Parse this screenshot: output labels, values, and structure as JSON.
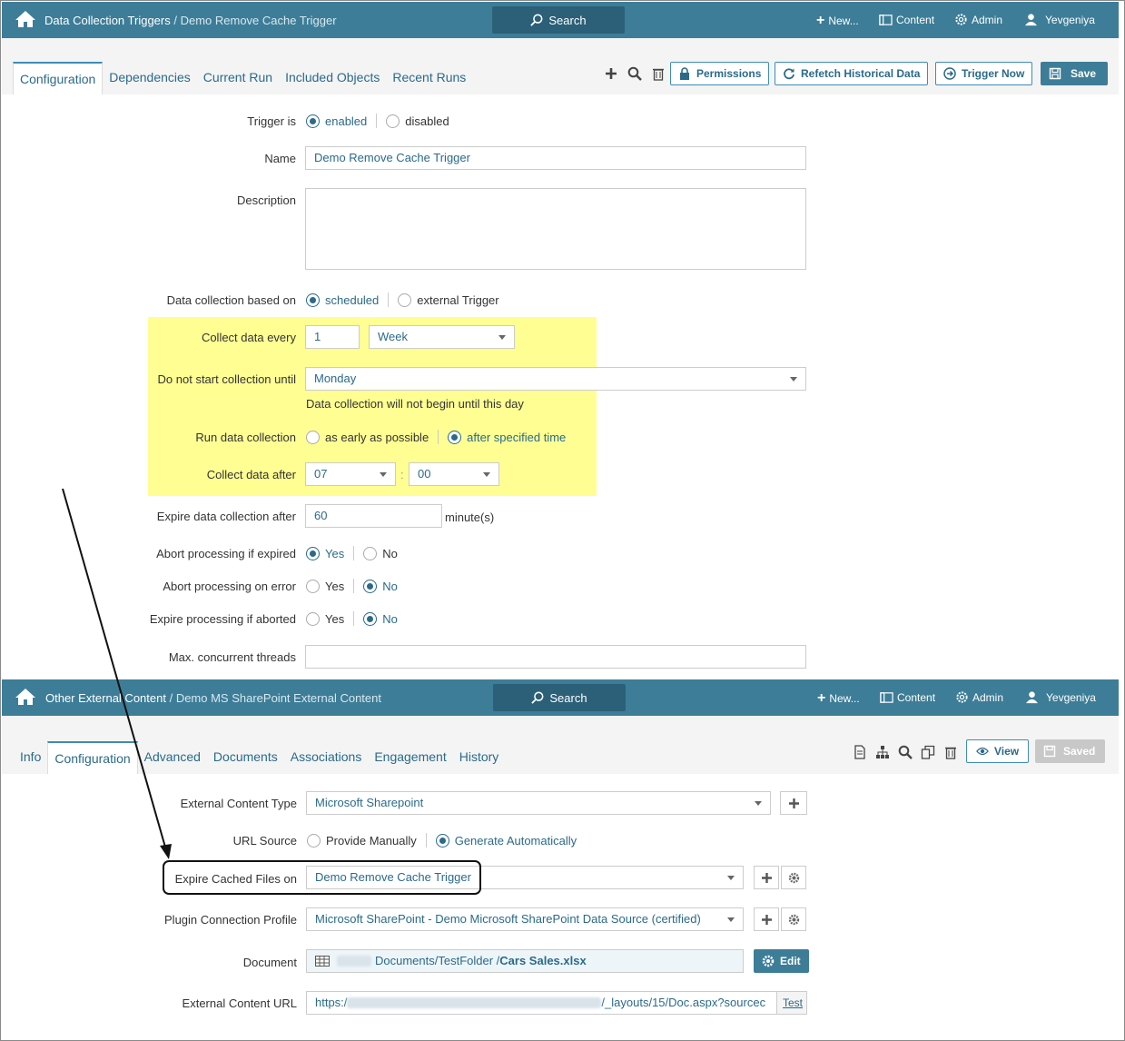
{
  "top": {
    "breadcrumb_main": "Data Collection Triggers",
    "breadcrumb_sep": " / ",
    "breadcrumb_sub": "Demo Remove Cache Trigger",
    "search_label": "Search",
    "nav_new": "New...",
    "nav_content": "Content",
    "nav_admin": "Admin",
    "nav_user": "Yevgeniya",
    "tabs": [
      "Configuration",
      "Dependencies",
      "Current Run",
      "Included Objects",
      "Recent Runs"
    ],
    "buttons": {
      "permissions": "Permissions",
      "refetch": "Refetch Historical Data",
      "trigger_now": "Trigger Now",
      "save": "Save"
    },
    "form": {
      "trigger_is_label": "Trigger is",
      "trigger_enabled": "enabled",
      "trigger_disabled": "disabled",
      "name_label": "Name",
      "name_value": "Demo Remove Cache Trigger",
      "description_label": "Description",
      "description_value": "",
      "based_on_label": "Data collection based on",
      "based_scheduled": "scheduled",
      "based_external": "external Trigger",
      "collect_every_label": "Collect data every",
      "collect_every_value": "1",
      "collect_every_unit": "Week",
      "not_start_label": "Do not start collection until",
      "not_start_value": "Monday",
      "not_start_help": "Data collection will not begin until this day",
      "run_label": "Run data collection",
      "run_early": "as early as possible",
      "run_after": "after specified time",
      "collect_after_label": "Collect data after",
      "collect_after_hour": "07",
      "time_sep": ":",
      "collect_after_min": "00",
      "expire_label": "Expire data collection after",
      "expire_value": "60",
      "expire_unit": "minute(s)",
      "abort_expired_label": "Abort processing if expired",
      "abort_error_label": "Abort processing on error",
      "expire_aborted_label": "Expire processing if aborted",
      "yes": "Yes",
      "no": "No",
      "max_threads_label": "Max. concurrent threads",
      "max_threads_value": ""
    }
  },
  "bottom": {
    "breadcrumb_main": "Other External Content",
    "breadcrumb_sep": " / ",
    "breadcrumb_sub": "Demo MS SharePoint External Content",
    "search_label": "Search",
    "nav_new": "New...",
    "nav_content": "Content",
    "nav_admin": "Admin",
    "nav_user": "Yevgeniya",
    "tabs": [
      "Info",
      "Configuration",
      "Advanced",
      "Documents",
      "Associations",
      "Engagement",
      "History"
    ],
    "buttons": {
      "view": "View",
      "saved": "Saved",
      "edit": "Edit",
      "test": "Test"
    },
    "form": {
      "ect_label": "External Content Type",
      "ect_value": "Microsoft Sharepoint",
      "url_source_label": "URL Source",
      "url_manual": "Provide Manually",
      "url_auto": "Generate Automatically",
      "expire_cached_label": "Expire Cached Files on",
      "expire_cached_value": "Demo Remove Cache Trigger",
      "plugin_label": "Plugin Connection Profile",
      "plugin_value": "Microsoft SharePoint - Demo Microsoft SharePoint Data Source (certified)",
      "document_label": "Document",
      "document_path": "Documents/TestFolder / ",
      "document_file": "Cars Sales.xlsx",
      "ext_url_label": "External Content URL",
      "ext_url_prefix": "https:/",
      "ext_url_suffix": "/_layouts/15/Doc.aspx?sourcec"
    }
  },
  "colors": {
    "header": "#3d7d98",
    "accent": "#2a6a8a",
    "highlight": "#fffd6f"
  }
}
